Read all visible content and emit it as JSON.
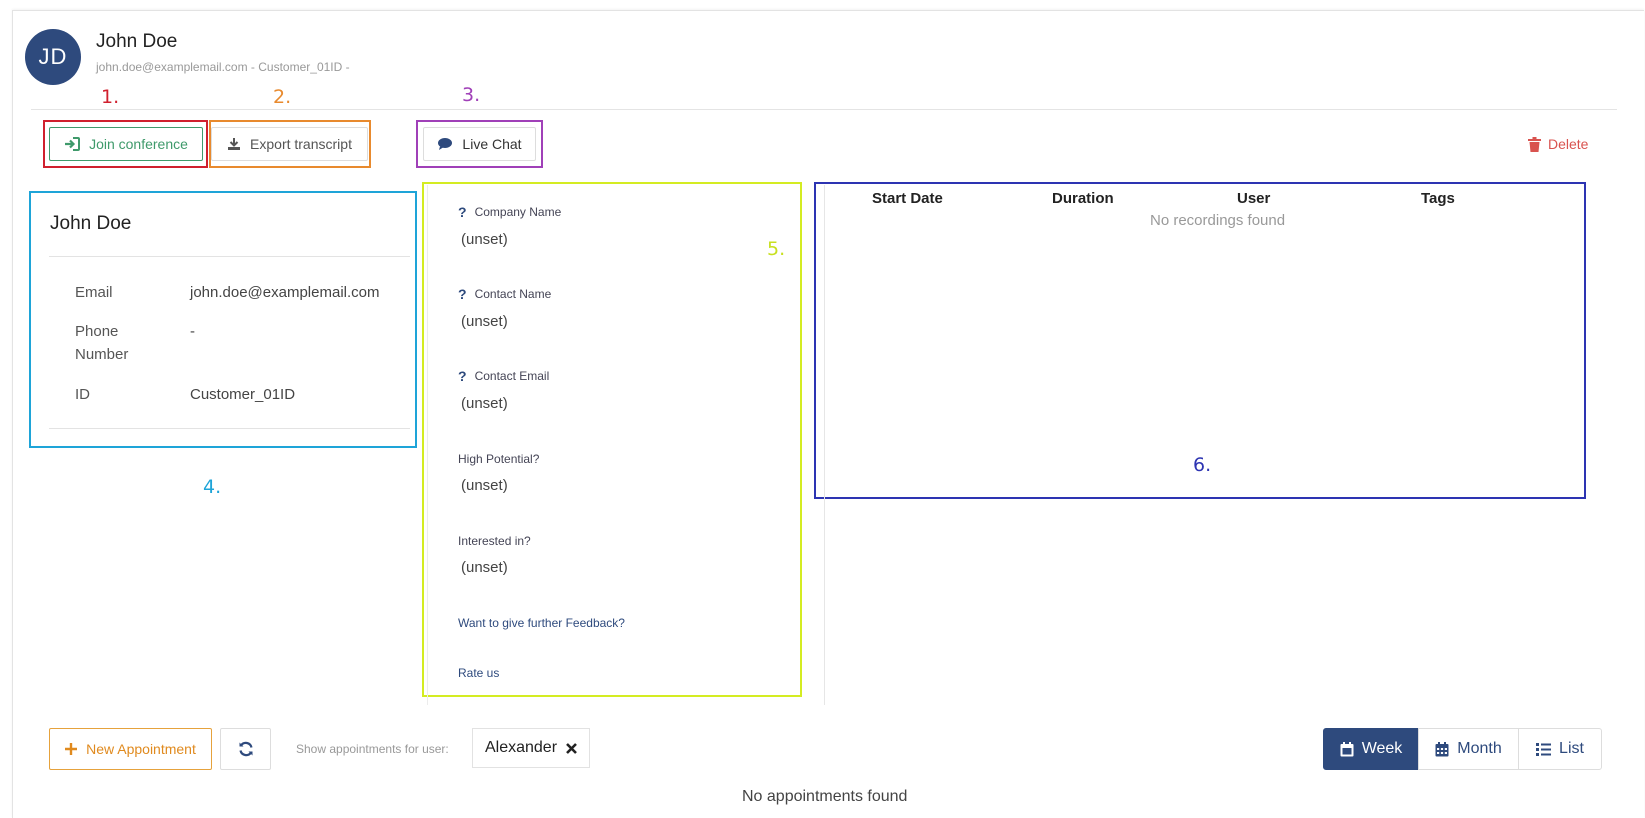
{
  "header": {
    "initials": "JD",
    "name": "John Doe",
    "subtitle": "john.doe@examplemail.com - Customer_01ID -"
  },
  "annotations": {
    "n1": "1.",
    "n2": "2.",
    "n3": "3.",
    "n4": "4.",
    "n5": "5.",
    "n6": "6.",
    "colors": {
      "n1": "#d0202e",
      "n2": "#e88a2e",
      "n3": "#a040b8",
      "n4": "#1ea4d8",
      "n5": "#d4ec22",
      "n6": "#2d34b2"
    }
  },
  "toolbar": {
    "join_label": "Join conference",
    "export_label": "Export transcript",
    "chat_label": "Live Chat",
    "delete_label": "Delete"
  },
  "customer_card": {
    "title": "John Doe",
    "rows": [
      {
        "label": "Email",
        "value": "john.doe@examplemail.com"
      },
      {
        "label": "Phone Number",
        "value": "-"
      },
      {
        "label": "ID",
        "value": "Customer_01ID"
      }
    ]
  },
  "form": {
    "fields": [
      {
        "label": "Company Name",
        "value": "(unset)"
      },
      {
        "label": "Contact Name",
        "value": "(unset)"
      },
      {
        "label": "Contact Email",
        "value": "(unset)"
      },
      {
        "label": "High Potential?",
        "value": "(unset)"
      },
      {
        "label": "Interested in?",
        "value": "(unset)"
      }
    ],
    "feedback_link": "Want to give further Feedback?",
    "rate_link": "Rate us"
  },
  "recordings": {
    "columns": [
      "Start Date",
      "Duration",
      "User",
      "Tags"
    ],
    "empty_message": "No recordings found"
  },
  "appointments": {
    "new_label": "New Appointment",
    "show_label": "Show appointments for user:",
    "user_filter": "Alexander",
    "view_options": [
      "Week",
      "Month",
      "List"
    ],
    "selected_view": "Week",
    "empty_message": "No appointments found"
  },
  "colors": {
    "primary": "#2e4a7d",
    "success": "#3f9a6b",
    "danger": "#d9534f",
    "warning": "#e08a1e"
  }
}
